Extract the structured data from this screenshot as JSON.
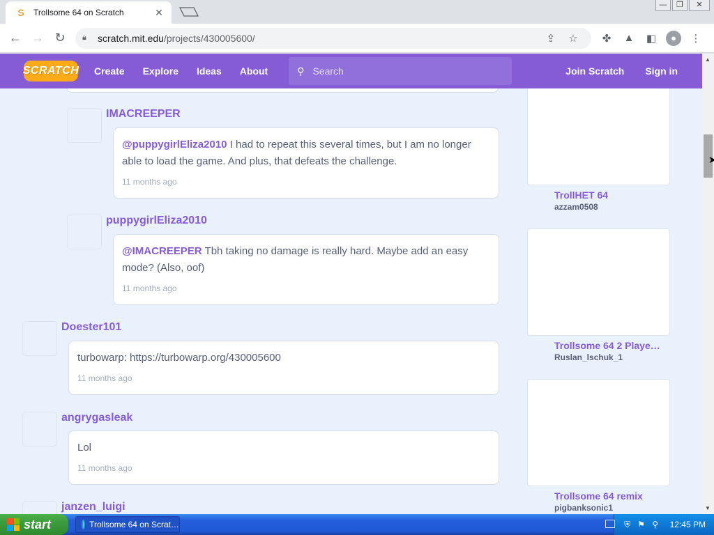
{
  "browser": {
    "tab_title": "Trollsome 64 on Scratch",
    "tab_favicon": "S",
    "tab_close": "✕",
    "url_domain": "scratch.mit.edu",
    "url_path": "/projects/430005600/"
  },
  "scratch_nav": {
    "logo": "SCRATCH",
    "links": [
      "Create",
      "Explore",
      "Ideas",
      "About"
    ],
    "search_placeholder": "Search",
    "join": "Join Scratch",
    "signin": "Sign in"
  },
  "comments": [
    {
      "user": "IMACREEPER",
      "mention": "@puppygirlEliza2010",
      "text": " I had to repeat this several times, but I am no longer able to load the game. And plus, that defeats the challenge.",
      "time": "11 months ago"
    },
    {
      "user": "puppygirlEliza2010",
      "mention": "@IMACREEPER",
      "text": " Tbh taking no damage is really hard. Maybe add an easy mode? (Also, oof)",
      "time": "11 months ago"
    },
    {
      "user": "Doester101",
      "mention": "",
      "text": "turbowarp: https://turbowarp.org/430005600",
      "time": "11 months ago"
    },
    {
      "user": "angrygasleak",
      "mention": "",
      "text": "Lol",
      "time": "11 months ago"
    },
    {
      "user": "janzen_luigi"
    }
  ],
  "remixes": [
    {
      "title": "TrollHET 64",
      "author": "azzam0508"
    },
    {
      "title": "Trollsome 64 2 Playe…",
      "author": "Ruslan_lschuk_1"
    },
    {
      "title": "Trollsome 64 remix",
      "author": "pigbanksonic1"
    }
  ],
  "taskbar": {
    "start": "start",
    "task_item": "Trollsome 64 on Scrat…",
    "clock": "12:45 PM"
  }
}
